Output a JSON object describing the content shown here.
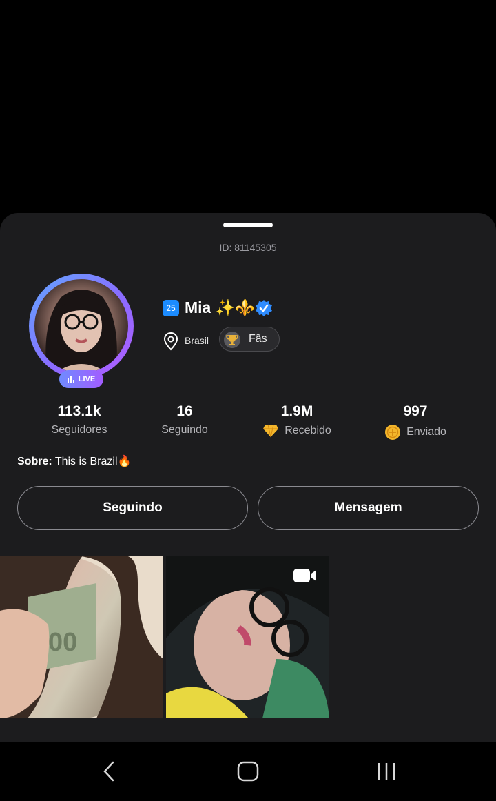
{
  "profile": {
    "id_text": "ID: 81145305",
    "level": "25",
    "name": "Mia ✨⚜️",
    "location": "Brasil",
    "fans_label": "Fãs",
    "live_label": "LIVE"
  },
  "stats": [
    {
      "value": "113.1k",
      "label": "Seguidores"
    },
    {
      "value": "16",
      "label": "Seguindo"
    },
    {
      "value": "1.9M",
      "label": "Recebido"
    },
    {
      "value": "997",
      "label": "Enviado"
    }
  ],
  "about": {
    "prefix": "Sobre:",
    "text": "This is Brazil🔥"
  },
  "buttons": {
    "follow": "Seguindo",
    "message": "Mensagem"
  },
  "colors": {
    "sheet_bg": "#1c1c1e",
    "accent_blue": "#1c8cff",
    "ring_gradient_start": "#61a7ff",
    "ring_gradient_end": "#b45cff"
  },
  "icons": {
    "verified": "verified-badge-icon",
    "location": "location-pin-icon",
    "trophy": "trophy-icon",
    "diamond": "diamond-icon",
    "coin": "coin-icon",
    "video": "video-camera-icon",
    "nav_back": "back-icon",
    "nav_home": "home-icon",
    "nav_recents": "recents-icon"
  }
}
